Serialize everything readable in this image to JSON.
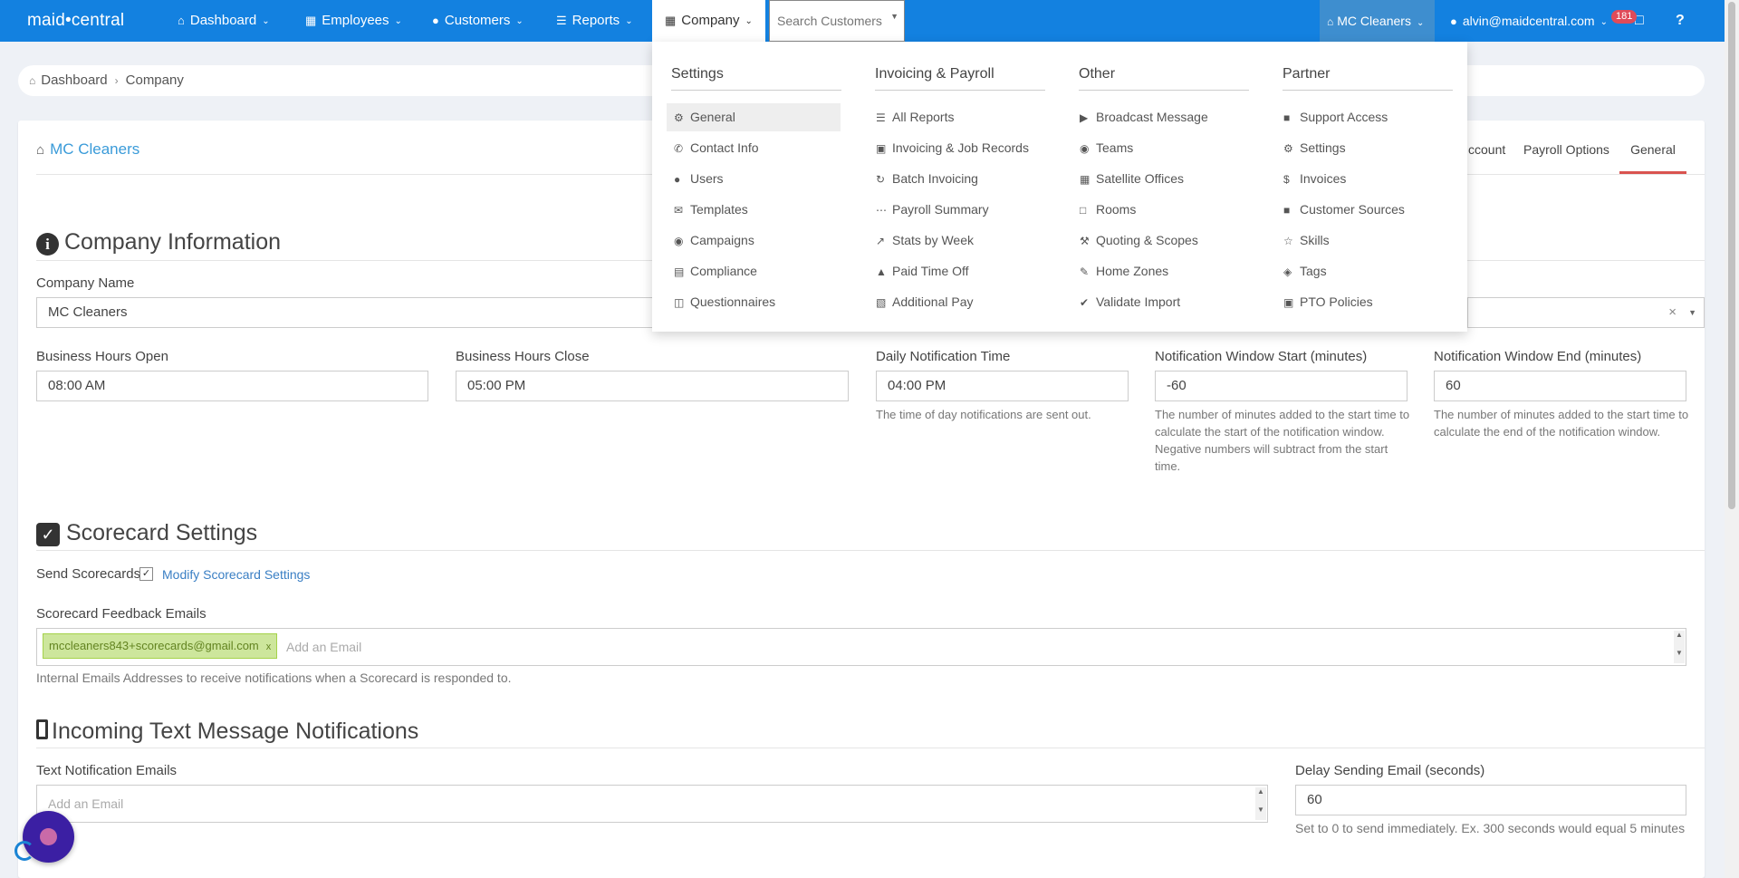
{
  "nav": {
    "logo": "maid•central",
    "items": [
      {
        "label": "Dashboard",
        "icon": "home-icon"
      },
      {
        "label": "Employees",
        "icon": "building-icon"
      },
      {
        "label": "Customers",
        "icon": "user-icon"
      },
      {
        "label": "Reports",
        "icon": "list-icon"
      },
      {
        "label": "Company",
        "icon": "building-icon"
      }
    ],
    "search_placeholder": "Search Customers",
    "company_switch": "MC Cleaners",
    "user_email": "alvin@maidcentral.com",
    "notification_count": "181",
    "primary_color": "#1381e0"
  },
  "breadcrumb": {
    "home": "Dashboard",
    "current": "Company"
  },
  "card": {
    "title": "MC Cleaners",
    "tabs": {
      "account_partial": "ccount",
      "payroll": "Payroll Options",
      "general": "General"
    }
  },
  "company_info": {
    "heading": "Company Information",
    "company_name_label": "Company Name",
    "company_name_value": "MC Cleaners",
    "right_select_clear": "×",
    "hours_open_label": "Business Hours Open",
    "hours_open_value": "08:00 AM",
    "hours_close_label": "Business Hours Close",
    "hours_close_value": "05:00 PM",
    "notif_time_label": "Daily Notification Time",
    "notif_time_value": "04:00 PM",
    "notif_time_help": "The time of day notifications are sent out.",
    "window_start_label": "Notification Window Start (minutes)",
    "window_start_value": "-60",
    "window_start_help": "The number of minutes added to the start time to calculate the start of the notification window. Negative numbers will subtract from the start time.",
    "window_end_label": "Notification Window End (minutes)",
    "window_end_value": "60",
    "window_end_help": "The number of minutes added to the start time to calculate the end of the notification window."
  },
  "scorecard": {
    "heading": "Scorecard Settings",
    "send_label": "Send Scorecards",
    "send_checked": true,
    "modify_link": "Modify Scorecard Settings",
    "emails_label": "Scorecard Feedback Emails",
    "email_tag": "mccleaners843+scorecards@gmail.com",
    "add_email_placeholder": "Add an Email",
    "emails_help": "Internal Emails Addresses to receive notifications when a Scorecard is responded to."
  },
  "incoming_text": {
    "heading": "Incoming Text Message Notifications",
    "emails_label": "Text Notification Emails",
    "add_email_placeholder": "Add an Email",
    "delay_label": "Delay Sending Email (seconds)",
    "delay_value": "60",
    "delay_help": "Set to 0 to send immediately. Ex. 300 seconds would equal 5 minutes"
  },
  "mega_menu": {
    "columns": [
      {
        "heading": "Settings",
        "items": [
          {
            "label": "General",
            "icon": "gear-icon"
          },
          {
            "label": "Contact Info",
            "icon": "phone-icon"
          },
          {
            "label": "Users",
            "icon": "user-icon"
          },
          {
            "label": "Templates",
            "icon": "envelope-icon"
          },
          {
            "label": "Campaigns",
            "icon": "users-icon"
          },
          {
            "label": "Compliance",
            "icon": "list-alt-icon"
          },
          {
            "label": "Questionnaires",
            "icon": "files-icon"
          }
        ]
      },
      {
        "heading": "Invoicing & Payroll",
        "items": [
          {
            "label": "All Reports",
            "icon": "list-icon"
          },
          {
            "label": "Invoicing & Job Records",
            "icon": "calendar-icon"
          },
          {
            "label": "Batch Invoicing",
            "icon": "refresh-icon"
          },
          {
            "label": "Payroll Summary",
            "icon": "ellipsis-icon"
          },
          {
            "label": "Stats by Week",
            "icon": "line-chart-icon"
          },
          {
            "label": "Paid Time Off",
            "icon": "birthday-cake-icon"
          },
          {
            "label": "Additional Pay",
            "icon": "cart-icon"
          }
        ]
      },
      {
        "heading": "Other",
        "items": [
          {
            "label": "Broadcast Message",
            "icon": "bullhorn-icon"
          },
          {
            "label": "Teams",
            "icon": "users-icon"
          },
          {
            "label": "Satellite Offices",
            "icon": "building-icon"
          },
          {
            "label": "Rooms",
            "icon": "square-icon"
          },
          {
            "label": "Quoting & Scopes",
            "icon": "wrench-icon"
          },
          {
            "label": "Home Zones",
            "icon": "pencil-icon"
          },
          {
            "label": "Validate Import",
            "icon": "check-icon"
          }
        ]
      },
      {
        "heading": "Partner",
        "items": [
          {
            "label": "Support Access",
            "icon": "lock-icon"
          },
          {
            "label": "Settings",
            "icon": "gears-icon"
          },
          {
            "label": "Invoices",
            "icon": "dollar-icon"
          },
          {
            "label": "Customer Sources",
            "icon": "lock-icon"
          },
          {
            "label": "Skills",
            "icon": "star-icon"
          },
          {
            "label": "Tags",
            "icon": "tags-icon"
          },
          {
            "label": "PTO Policies",
            "icon": "calendar-icon"
          }
        ]
      }
    ]
  }
}
